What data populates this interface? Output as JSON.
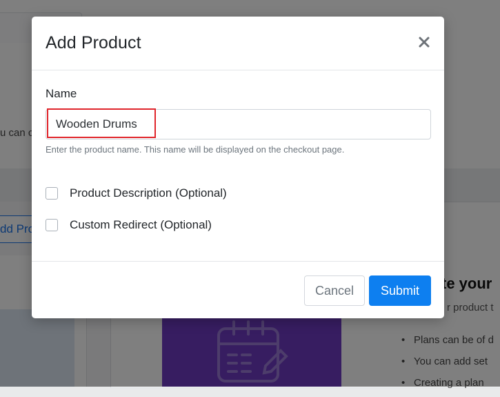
{
  "background": {
    "text_fragment": "u can c",
    "add_button_fragment": "dd Pro",
    "heading_fragment": "te your",
    "subtext_fragment": "r product t",
    "list_items": [
      "Plans can be of d",
      "You can add set",
      "Creating a plan"
    ]
  },
  "modal": {
    "title": "Add Product",
    "close_label": "×",
    "name_field": {
      "label": "Name",
      "value": "Wooden Drums",
      "help": "Enter the product name. This name will be displayed on the checkout page."
    },
    "options": [
      {
        "label": "Product Description (Optional)",
        "checked": false
      },
      {
        "label": "Custom Redirect (Optional)",
        "checked": false
      }
    ],
    "cancel_label": "Cancel",
    "submit_label": "Submit"
  },
  "colors": {
    "primary": "#0d7ff0",
    "highlight": "#e0242a",
    "illustration": "#6f3ac2"
  }
}
